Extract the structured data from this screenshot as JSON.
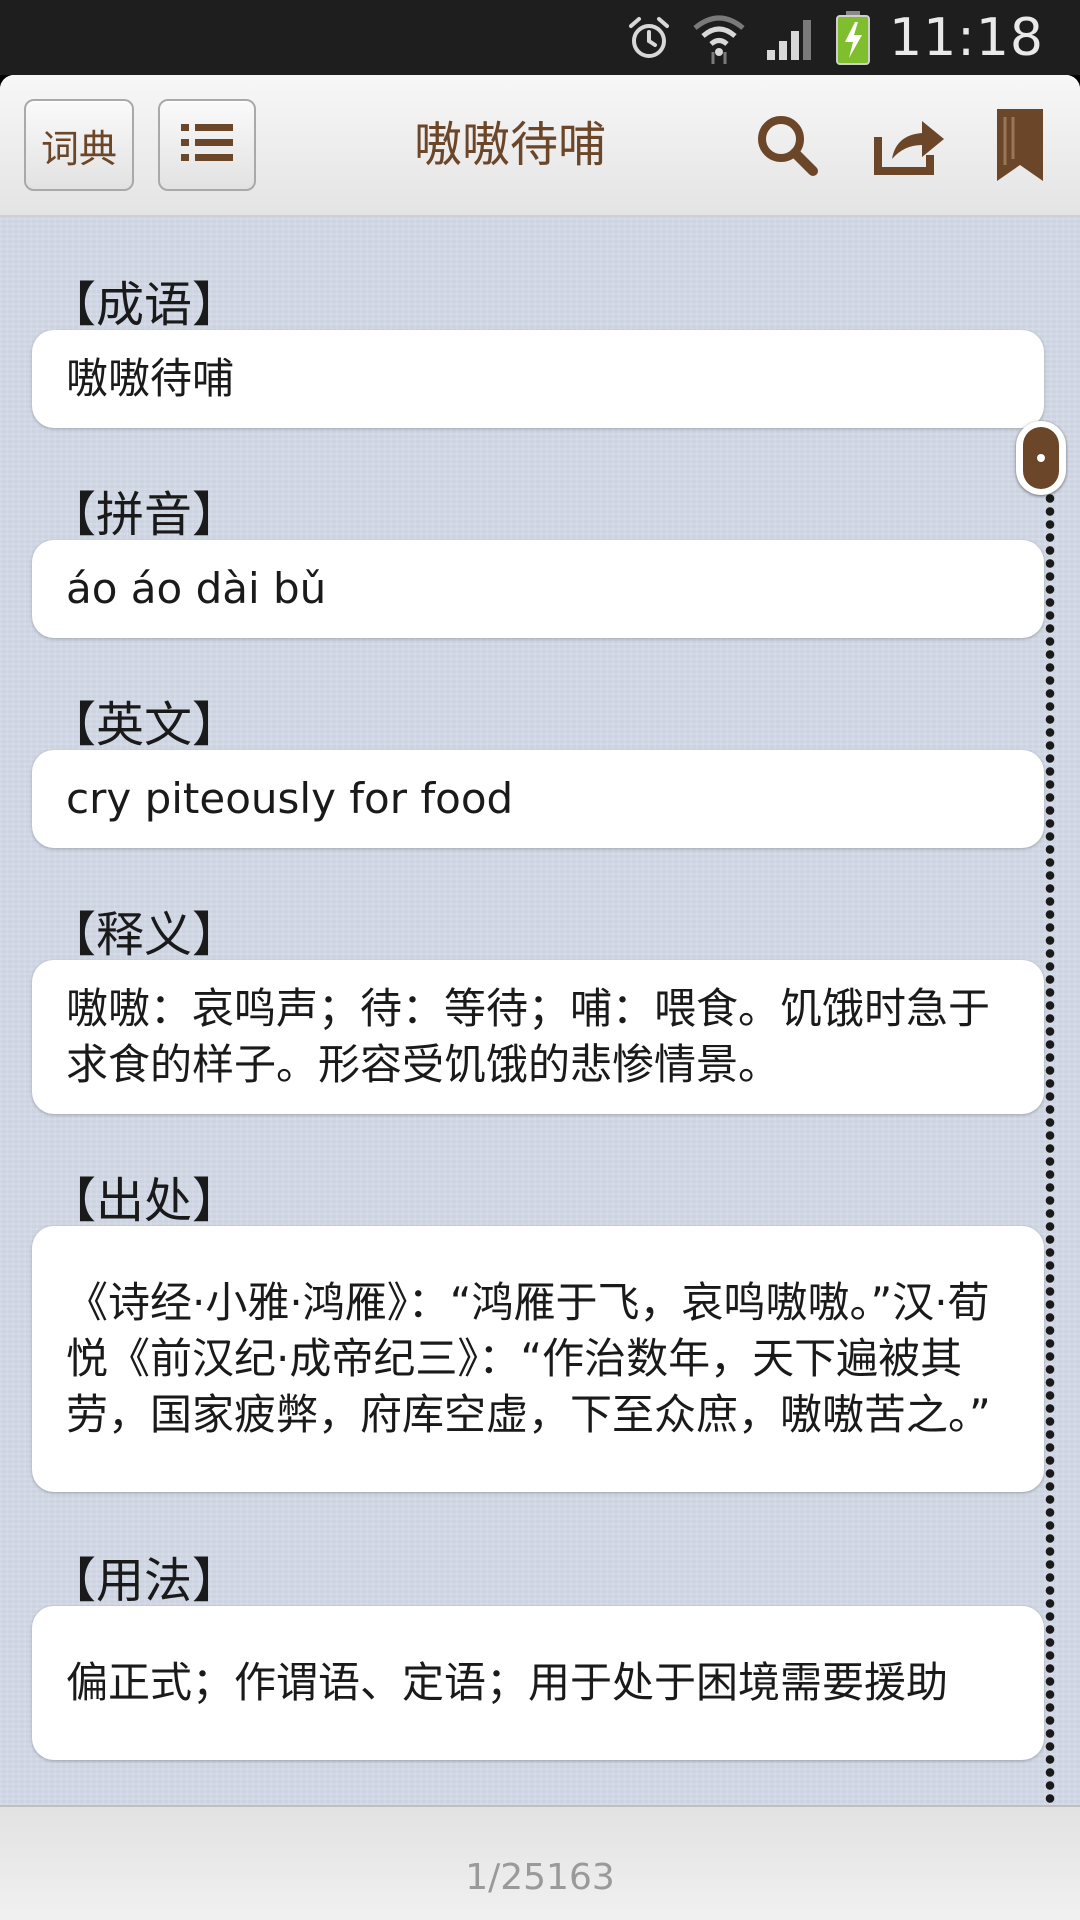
{
  "status_bar": {
    "time": "11:18",
    "icons": [
      "alarm-icon",
      "wifi-icon",
      "signal-icon",
      "battery-charging-icon"
    ]
  },
  "header": {
    "dict_button_label": "词典",
    "list_button_icon": "list-icon",
    "title": "嗷嗷待哺",
    "actions": [
      "search-icon",
      "share-icon",
      "bookmark-icon"
    ]
  },
  "entry": {
    "idiom_label": "【成语】",
    "idiom": "嗷嗷待哺",
    "pinyin_label": "【拼音】",
    "pinyin": "áo áo dài bǔ",
    "english_label": "【英文】",
    "english": "cry piteously for food",
    "meaning_label": "【释义】",
    "meaning": "嗷嗷：哀鸣声；待：等待；哺：喂食。饥饿时急于求食的样子。形容受饥饿的悲惨情景。",
    "source_label": "【出处】",
    "source": "《诗经·小雅·鸿雁》：“鸿雁于飞，哀鸣嗷嗷。”汉·荀悦《前汉纪·成帝纪三》：“作治数年，天下遍被其劳，国家疲弊，府库空虚，下至众庶，嗷嗷苦之。”",
    "usage_label": "【用法】",
    "usage": "偏正式；作谓语、定语；用于处于困境需要援助"
  },
  "footer": {
    "page_counter": "1/25163"
  },
  "colors": {
    "accent_brown": "#6b4628",
    "content_bg": "#ccd3e1",
    "card_bg": "#ffffff"
  }
}
